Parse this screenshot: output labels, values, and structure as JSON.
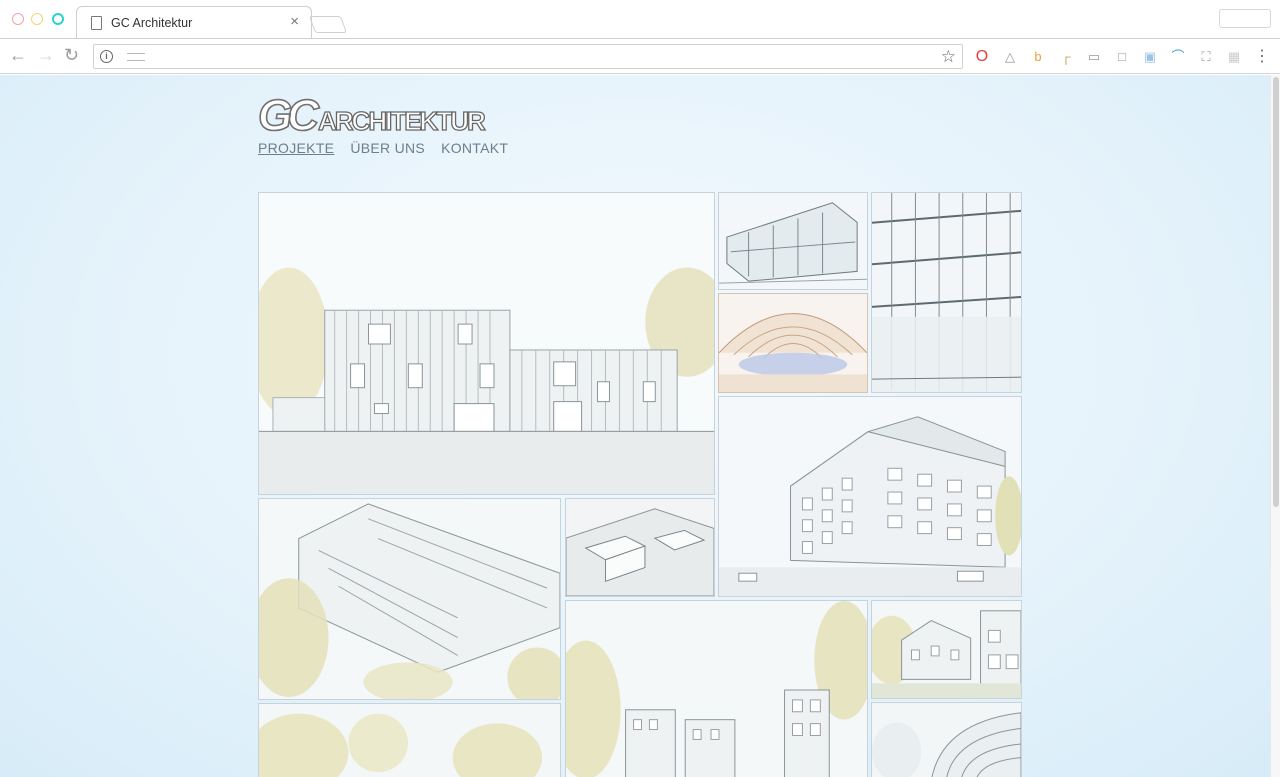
{
  "browser": {
    "tab_title": "GC Architektur",
    "tab_close": "×",
    "nav_back": "←",
    "nav_forward": "→",
    "nav_reload": "↻",
    "info_glyph": "i",
    "star_glyph": "☆",
    "menu_glyph": "⋮"
  },
  "site": {
    "logo_gc": "GC",
    "logo_rest": "ARCHITEKTUR",
    "nav": [
      {
        "label": "PROJEKTE",
        "active": true
      },
      {
        "label": "ÜBER UNS",
        "active": false
      },
      {
        "label": "KONTAKT",
        "active": false
      }
    ]
  },
  "colors": {
    "page_bg": "#e6f3fb",
    "nav_text": "#6c7f8c",
    "sketch_line": "#8c969c",
    "foliage": "#c9c58b"
  },
  "gallery": {
    "tiles": [
      {
        "name": "project-tile-timber-house",
        "subject": "timber house elevation"
      },
      {
        "name": "project-tile-cantilever-glass",
        "subject": "cantilevered glass pavilion"
      },
      {
        "name": "project-tile-office-facade",
        "subject": "office facade"
      },
      {
        "name": "project-tile-timber-hall",
        "subject": "timber vaulted hall"
      },
      {
        "name": "project-tile-corner-block",
        "subject": "corner apartment block"
      },
      {
        "name": "project-tile-housing-aerial",
        "subject": "housing aerial view"
      },
      {
        "name": "project-tile-site-model",
        "subject": "site model"
      },
      {
        "name": "project-tile-street-view",
        "subject": "street view"
      },
      {
        "name": "project-tile-terraced-house",
        "subject": "terraced house"
      },
      {
        "name": "project-tile-trees-bottom",
        "subject": "trees"
      },
      {
        "name": "project-tile-curved-facade",
        "subject": "curved facade"
      }
    ]
  }
}
